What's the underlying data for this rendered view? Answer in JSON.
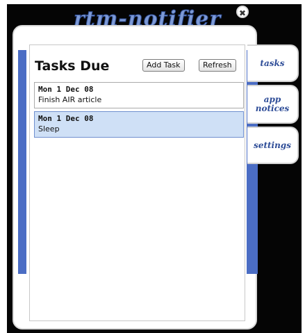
{
  "app": {
    "logo_text": "rtm-notifier",
    "close_glyph": "✖"
  },
  "tasks_panel": {
    "title": "Tasks Due",
    "add_task_label": "Add Task",
    "refresh_label": "Refresh",
    "tasks": [
      {
        "date": "Mon 1 Dec 08",
        "name": "Finish AIR article",
        "selected": false
      },
      {
        "date": "Mon 1 Dec 08",
        "name": "Sleep",
        "selected": true
      }
    ]
  },
  "tabs": [
    {
      "label": "tasks"
    },
    {
      "label": "app notices"
    },
    {
      "label": "settings"
    }
  ],
  "colors": {
    "accent_blue": "#4b6dc4",
    "selected_row": "#cfe0f6",
    "tab_text": "#2d4c97",
    "logo_fill": "#7d9ad6"
  }
}
